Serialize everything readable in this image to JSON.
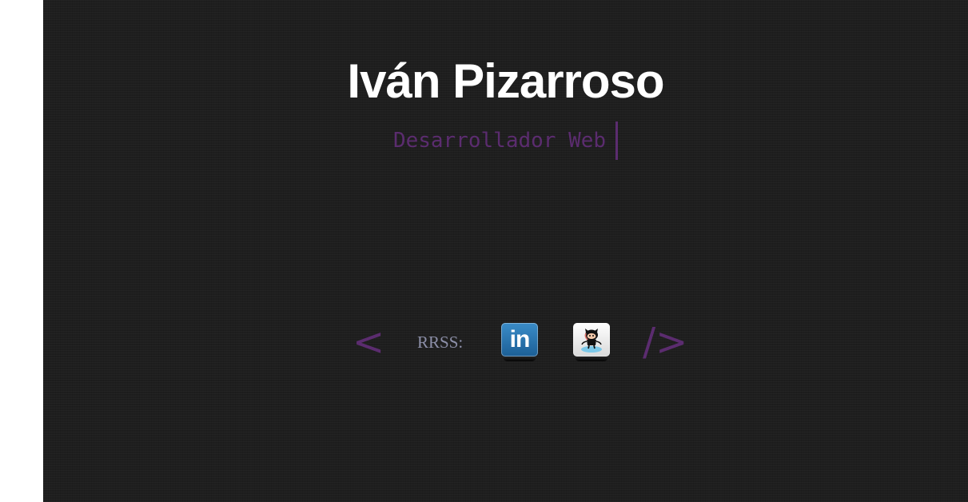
{
  "header": {
    "name": "Iván Pizarroso",
    "role": "Desarrollador Web"
  },
  "social": {
    "open_bracket": "<",
    "close_bracket": "/>",
    "label": "RRSS:",
    "links": [
      {
        "name": "LinkedIn",
        "icon": "linkedin-icon",
        "glyph": "in",
        "color": "#2a77b3"
      },
      {
        "name": "GitHub",
        "icon": "github-octocat-icon",
        "color": "#ffffff"
      }
    ]
  },
  "colors": {
    "background": "#1e1e1e",
    "accent": "#5b2c6f",
    "name_text": "#ffffff",
    "label_text": "#8c8fa8"
  }
}
